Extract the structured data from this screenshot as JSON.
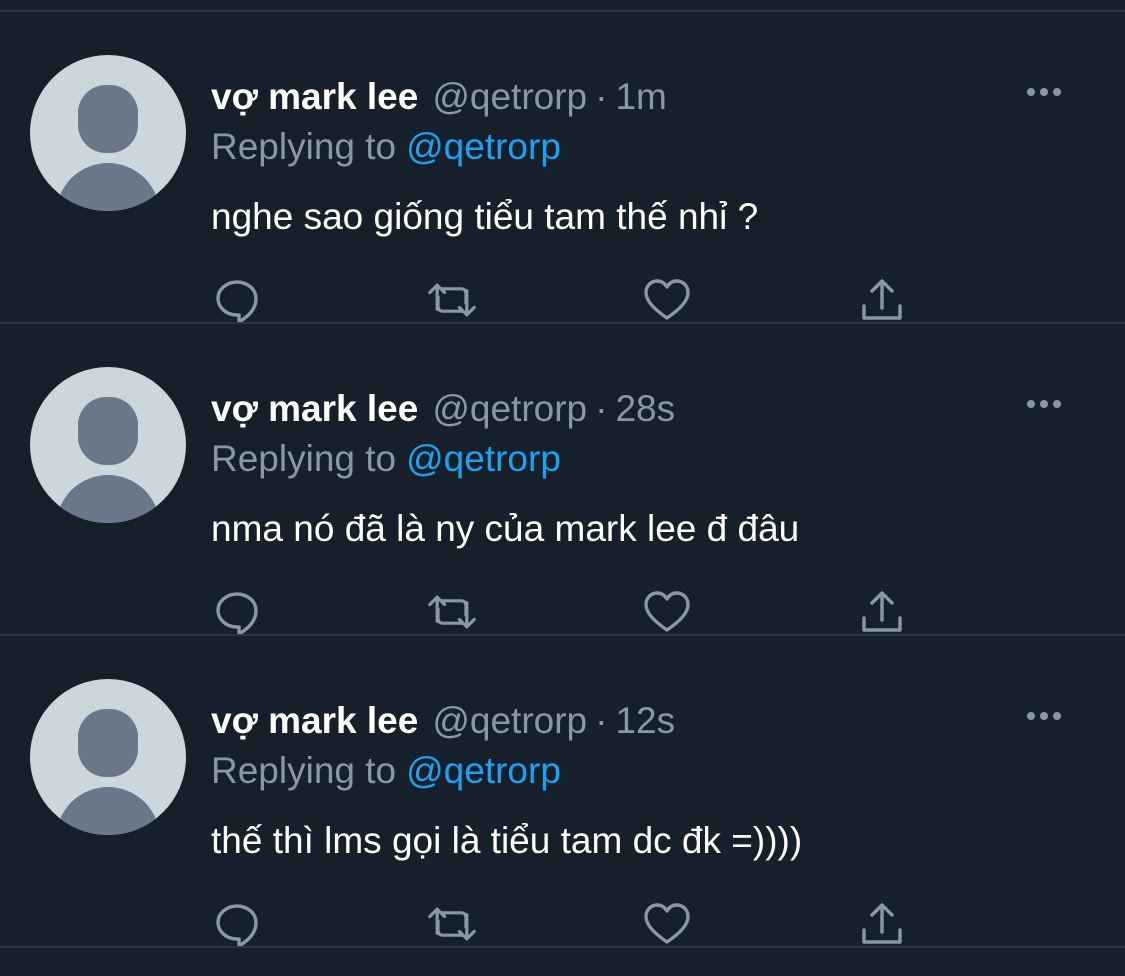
{
  "theme": {
    "background": "#15202b",
    "divider": "#2b3640",
    "primary_text": "#ffffff",
    "secondary_text": "#8899a6",
    "accent": "#1da1f2",
    "avatar_bg": "#ccd6dd",
    "avatar_fg": "#687888"
  },
  "tweets": [
    {
      "name": "vợ mark lee",
      "handle": "@qetrorp",
      "separator": "·",
      "time": "1m",
      "reply_prefix": "Replying to",
      "reply_to": "@qetrorp",
      "text": "nghe sao giống tiểu tam thế nhỉ ?",
      "icons": [
        "reply-icon",
        "retweet-icon",
        "like-icon",
        "share-icon",
        "more-icon"
      ]
    },
    {
      "name": "vợ mark lee",
      "handle": "@qetrorp",
      "separator": "·",
      "time": "28s",
      "reply_prefix": "Replying to",
      "reply_to": "@qetrorp",
      "text": "nma nó đã là ny của mark lee đ đâu",
      "icons": [
        "reply-icon",
        "retweet-icon",
        "like-icon",
        "share-icon",
        "more-icon"
      ]
    },
    {
      "name": "vợ mark lee",
      "handle": "@qetrorp",
      "separator": "·",
      "time": "12s",
      "reply_prefix": "Replying to",
      "reply_to": "@qetrorp",
      "text": "thế thì lms gọi là tiểu tam dc đk =))))",
      "icons": [
        "reply-icon",
        "retweet-icon",
        "like-icon",
        "share-icon",
        "more-icon"
      ]
    }
  ]
}
